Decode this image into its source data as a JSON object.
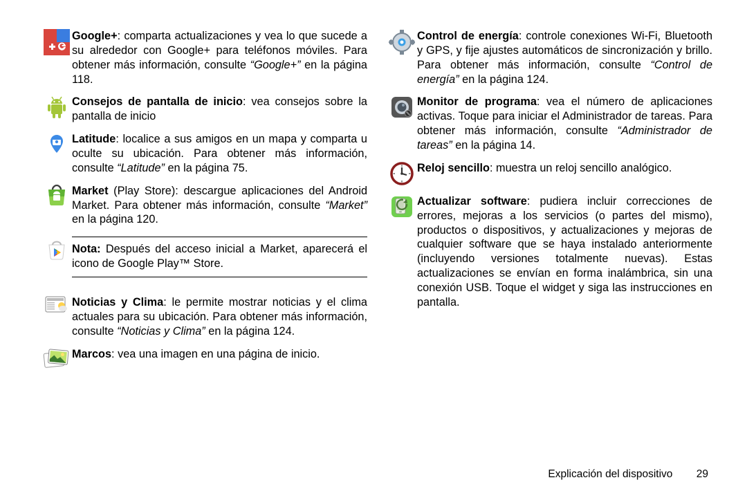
{
  "col1": {
    "e0": {
      "title": "Google+",
      "sep": ": ",
      "body1": "comparta actualizaciones y vea lo que sucede a su alrededor con Google+ para teléfonos móviles. Para obtener más información, consulte ",
      "ref": "“Google+”",
      "body2": " en la página 118."
    },
    "e1": {
      "title": "Consejos de pantalla de inicio",
      "sep": ": ",
      "body1": "vea consejos sobre la pantalla de inicio"
    },
    "e2": {
      "title": "Latitude",
      "sep": ": ",
      "body1": "localice a sus amigos en un mapa y comparta u oculte su ubicación. Para obtener más información, consulte ",
      "ref": "“Latitude”",
      "body2": " en la página 75."
    },
    "e3": {
      "title": "Market",
      "sep": " (Play Store): ",
      "body1": "descargue aplicaciones del Android Market. Para obtener más información, consulte ",
      "ref": "“Market”",
      "body2": " en la página 120."
    },
    "note": {
      "title": "Nota:",
      "body": " Después del acceso inicial a Market, aparecerá el icono de Google Play™ Store."
    },
    "e4": {
      "title": "Noticias y Clima",
      "sep": ": ",
      "body1": "le permite mostrar noticias y el clima actuales para su ubicación. Para obtener más información, consulte ",
      "ref": "“Noticias y Clima”",
      "body2": " en la página 124."
    },
    "e5": {
      "title": "Marcos",
      "sep": ": ",
      "body1": "vea una imagen en una página de inicio."
    }
  },
  "col2": {
    "e0": {
      "title": "Control de energía",
      "sep": ": ",
      "body1": "controle conexiones Wi-Fi, Bluetooth y GPS, y fije ajustes automáticos de sincronización y brillo. Para obtener más información, consulte ",
      "ref": "“Control de energía”",
      "body2": " en la página 124."
    },
    "e1": {
      "title": "Monitor de programa",
      "sep": ": ",
      "body1": "vea el número de aplicaciones activas. Toque para iniciar el Administrador de tareas. Para obtener más información, consulte ",
      "ref": "“Administrador de tareas”",
      "body2": " en la página 14."
    },
    "e2": {
      "title": "Reloj sencillo",
      "sep": ": ",
      "body1": "muestra un reloj sencillo analógico."
    },
    "e3": {
      "title": "Actualizar software",
      "sep": ": ",
      "body1": "pudiera incluir correcciones de errores, mejoras a los servicios (o partes del mismo), productos o dispositivos, y actualizaciones y mejoras de cualquier software que se haya instalado anteriormente (incluyendo versiones totalmente nuevas). Estas actualizaciones se envían en forma inalámbrica, sin una conexión USB. Toque el widget y siga las instrucciones en pantalla."
    }
  },
  "footer": {
    "section": "Explicación del dispositivo",
    "page": "29"
  }
}
